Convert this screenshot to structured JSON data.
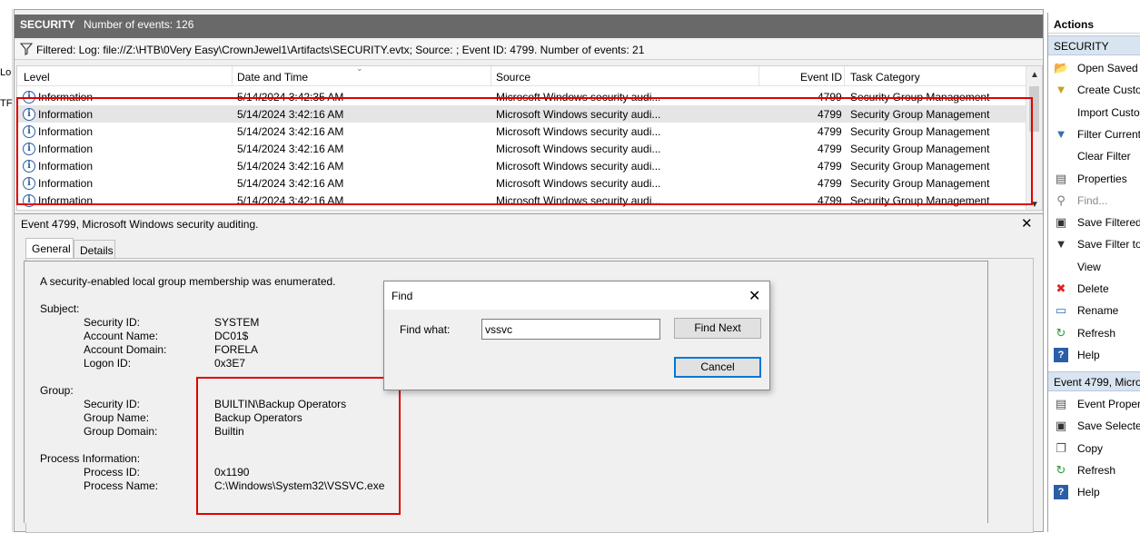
{
  "left_edge": {
    "fragments": [
      "Lo",
      "TF"
    ]
  },
  "header": {
    "title": "SECURITY",
    "event_count": "Number of events: 126"
  },
  "filter": {
    "text": "Filtered: Log: file://Z:\\HTB\\0Very Easy\\CrownJewel1\\Artifacts\\SECURITY.evtx; Source: ; Event ID: 4799. Number of events: 21"
  },
  "grid": {
    "columns": [
      "Level",
      "Date and Time",
      "Source",
      "Event ID",
      "Task Category"
    ],
    "rows": [
      {
        "level": "Information",
        "date": "5/14/2024 3:42:35 AM",
        "source": "Microsoft Windows security audi...",
        "event_id": "4799",
        "task": "Security Group Management"
      },
      {
        "level": "Information",
        "date": "5/14/2024 3:42:16 AM",
        "source": "Microsoft Windows security audi...",
        "event_id": "4799",
        "task": "Security Group Management"
      },
      {
        "level": "Information",
        "date": "5/14/2024 3:42:16 AM",
        "source": "Microsoft Windows security audi...",
        "event_id": "4799",
        "task": "Security Group Management"
      },
      {
        "level": "Information",
        "date": "5/14/2024 3:42:16 AM",
        "source": "Microsoft Windows security audi...",
        "event_id": "4799",
        "task": "Security Group Management"
      },
      {
        "level": "Information",
        "date": "5/14/2024 3:42:16 AM",
        "source": "Microsoft Windows security audi...",
        "event_id": "4799",
        "task": "Security Group Management"
      },
      {
        "level": "Information",
        "date": "5/14/2024 3:42:16 AM",
        "source": "Microsoft Windows security audi...",
        "event_id": "4799",
        "task": "Security Group Management"
      },
      {
        "level": "Information",
        "date": "5/14/2024 3:42:16 AM",
        "source": "Microsoft Windows security audi...",
        "event_id": "4799",
        "task": "Security Group Management"
      }
    ]
  },
  "detail": {
    "header": "Event 4799, Microsoft Windows security auditing.",
    "close": "✕",
    "tabs": [
      "General",
      "Details"
    ],
    "description": "A security-enabled local group membership was enumerated.",
    "subject_label": "Subject:",
    "subject": [
      {
        "k": "Security ID:",
        "v": "SYSTEM"
      },
      {
        "k": "Account Name:",
        "v": "DC01$"
      },
      {
        "k": "Account Domain:",
        "v": "FORELA"
      },
      {
        "k": "Logon ID:",
        "v": "0x3E7"
      }
    ],
    "group_label": "Group:",
    "group": [
      {
        "k": "Security ID:",
        "v": "BUILTIN\\Backup Operators"
      },
      {
        "k": "Group Name:",
        "v": "Backup Operators"
      },
      {
        "k": "Group Domain:",
        "v": "Builtin"
      }
    ],
    "process_label": "Process Information:",
    "process": [
      {
        "k": "Process ID:",
        "v": "0x1190"
      },
      {
        "k": "Process Name:",
        "v": "C:\\Windows\\System32\\VSSVC.exe"
      }
    ]
  },
  "find_dialog": {
    "title": "Find",
    "close": "✕",
    "find_what_label": "Find what:",
    "find_what_value": "vssvc",
    "find_next": "Find Next",
    "cancel": "Cancel"
  },
  "actions": {
    "title": "Actions",
    "section1": "SECURITY",
    "items1": [
      {
        "label": "Open Saved L",
        "icon": "folder-icon",
        "glyph": "📂"
      },
      {
        "label": "Create Custo",
        "icon": "create-filter-icon",
        "glyph": "▼"
      },
      {
        "label": "Import Custo",
        "icon": "blank-icon",
        "glyph": ""
      },
      {
        "label": "Filter Current",
        "icon": "filter-icon",
        "glyph": "▼"
      },
      {
        "label": "Clear Filter",
        "icon": "blank-icon",
        "glyph": ""
      },
      {
        "label": "Properties",
        "icon": "properties-icon",
        "glyph": "▤"
      },
      {
        "label": "Find...",
        "icon": "binoculars-icon",
        "glyph": "⚲"
      },
      {
        "label": "Save Filtered",
        "icon": "save-icon",
        "glyph": "▣"
      },
      {
        "label": "Save Filter to",
        "icon": "save-filter-icon",
        "glyph": "▼"
      },
      {
        "label": "View",
        "icon": "blank-icon",
        "glyph": ""
      },
      {
        "label": "Delete",
        "icon": "delete-icon",
        "glyph": "✖"
      },
      {
        "label": "Rename",
        "icon": "rename-icon",
        "glyph": "▭"
      },
      {
        "label": "Refresh",
        "icon": "refresh-icon",
        "glyph": "↻"
      },
      {
        "label": "Help",
        "icon": "help-icon",
        "glyph": "?"
      }
    ],
    "section2": "Event 4799, Micro",
    "items2": [
      {
        "label": "Event Propert",
        "icon": "event-properties-icon",
        "glyph": "▤"
      },
      {
        "label": "Save Selected",
        "icon": "save-icon",
        "glyph": "▣"
      },
      {
        "label": "Copy",
        "icon": "copy-icon",
        "glyph": "❐"
      },
      {
        "label": "Refresh",
        "icon": "refresh-icon",
        "glyph": "↻"
      },
      {
        "label": "Help",
        "icon": "help-icon",
        "glyph": "?"
      }
    ]
  },
  "colors": {
    "highlight_red": "#e00000",
    "title_bar": "#696969",
    "accent_blue": "#0078d7",
    "section_blue": "#d9e4f1"
  }
}
